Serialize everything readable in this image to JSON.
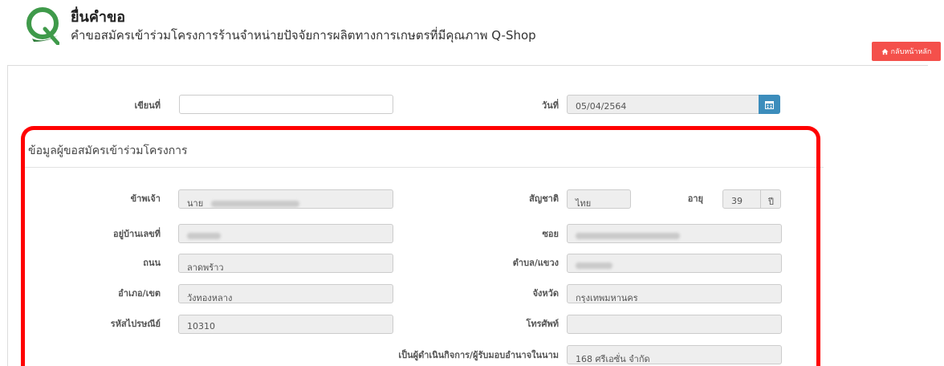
{
  "header": {
    "title": "ยื่นคำขอ",
    "subtitle": "คำขอสมัครเข้าร่วมโครงการร้านจำหน่ายปัจจัยการผลิตทางการเกษตรที่มีคุณภาพ Q-Shop",
    "back_button": "กลับหน้าหลัก"
  },
  "form_top": {
    "written_at_label": "เขียนที่",
    "written_at_value": "",
    "date_label": "วันที่",
    "date_value": "05/04/2564"
  },
  "applicant": {
    "section_title": "ข้อมูลผู้ขอสมัครเข้าร่วมโครงการ",
    "name_label": "ข้าพเจ้า",
    "name_prefix": "นาย",
    "nationality_label": "สัญชาติ",
    "nationality_value": "ไทย",
    "age_label": "อายุ",
    "age_value": "39",
    "age_unit": "ปี",
    "house_no_label": "อยู่บ้านเลขที่",
    "soi_label": "ซอย",
    "road_label": "ถนน",
    "road_value": "ลาดพร้าว",
    "subdistrict_label": "ตำบล/แขวง",
    "district_label": "อำเภอ/เขต",
    "district_value": "วังทองหลาง",
    "province_label": "จังหวัด",
    "province_value": "กรุงเทพมหานคร",
    "postal_label": "รหัสไปรษณีย์",
    "postal_value": "10310",
    "phone_label": "โทรศัพท์",
    "phone_value": "",
    "operator_label": "เป็นผู้ดำเนินกิจการ/ผู้รับมอบอำนาจในนาม",
    "operator_value": "168 ศรีเอซั่น จำกัด"
  },
  "colors": {
    "accent_red": "#f4504b",
    "highlight_border": "#ff0000",
    "calendar_button": "#3c8dbc",
    "logo_green": "#3f9a4a"
  }
}
